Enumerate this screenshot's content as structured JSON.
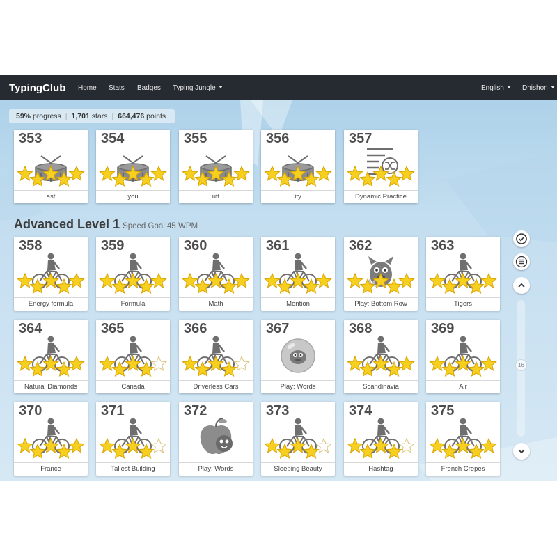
{
  "navbar": {
    "brand": "TypingClub",
    "home": "Home",
    "stats": "Stats",
    "badges": "Badges",
    "typing_jungle": "Typing Jungle",
    "language": "English",
    "user": "Dhishon"
  },
  "progress": {
    "percent": "59%",
    "percent_word": "progress",
    "stars": "1,701",
    "stars_word": "stars",
    "points": "664,476",
    "points_word": "points"
  },
  "section": {
    "title": "Advanced Level 1",
    "subtitle": "Speed Goal 45 WPM"
  },
  "scroll": {
    "position": "16"
  },
  "lessons": [
    {
      "num": "353",
      "label": "ast",
      "icon": "drum-icon",
      "stars": 5
    },
    {
      "num": "354",
      "label": "you",
      "icon": "drum-icon",
      "stars": 5
    },
    {
      "num": "355",
      "label": "utt",
      "icon": "drum-icon",
      "stars": 5
    },
    {
      "num": "356",
      "label": "ity",
      "icon": "drum-icon",
      "stars": 5
    },
    {
      "num": "357",
      "label": "Dynamic Practice",
      "icon": "shuffle-list-icon",
      "stars": 5
    },
    {
      "num": "358",
      "label": "Energy formula",
      "icon": "cyclist-icon",
      "stars": 5
    },
    {
      "num": "359",
      "label": "Formula",
      "icon": "cyclist-icon",
      "stars": 5
    },
    {
      "num": "360",
      "label": "Math",
      "icon": "cyclist-icon",
      "stars": 5
    },
    {
      "num": "361",
      "label": "Mention",
      "icon": "cyclist-icon",
      "stars": 5
    },
    {
      "num": "362",
      "label": "Play: Bottom Row",
      "icon": "game-character-icon",
      "stars": 5
    },
    {
      "num": "363",
      "label": "Tigers",
      "icon": "cyclist-icon",
      "stars": 5
    },
    {
      "num": "364",
      "label": "Natural Diamonds",
      "icon": "cyclist-icon",
      "stars": 5
    },
    {
      "num": "365",
      "label": "Canada",
      "icon": "cyclist-icon",
      "stars": 4
    },
    {
      "num": "366",
      "label": "Driverless Cars",
      "icon": "cyclist-icon",
      "stars": 4
    },
    {
      "num": "367",
      "label": "Play: Words",
      "icon": "bubble-game-icon",
      "stars": 0
    },
    {
      "num": "368",
      "label": "Scandinavia",
      "icon": "cyclist-icon",
      "stars": 5
    },
    {
      "num": "369",
      "label": "Air",
      "icon": "cyclist-icon",
      "stars": 5
    },
    {
      "num": "370",
      "label": "France",
      "icon": "cyclist-icon",
      "stars": 5
    },
    {
      "num": "371",
      "label": "Tallest Building",
      "icon": "cyclist-icon",
      "stars": 4
    },
    {
      "num": "372",
      "label": "Play: Words",
      "icon": "apple-game-icon",
      "stars": 0
    },
    {
      "num": "373",
      "label": "Sleeping Beauty",
      "icon": "cyclist-icon",
      "stars": 4
    },
    {
      "num": "374",
      "label": "Hashtag",
      "icon": "cyclist-icon",
      "stars": 4
    },
    {
      "num": "375",
      "label": "French Crepes",
      "icon": "cyclist-icon",
      "stars": 5
    }
  ],
  "colors": {
    "navbar": "#262a31",
    "star_gold": "#f7cf1f",
    "icon_gray": "#6f6f6f"
  }
}
